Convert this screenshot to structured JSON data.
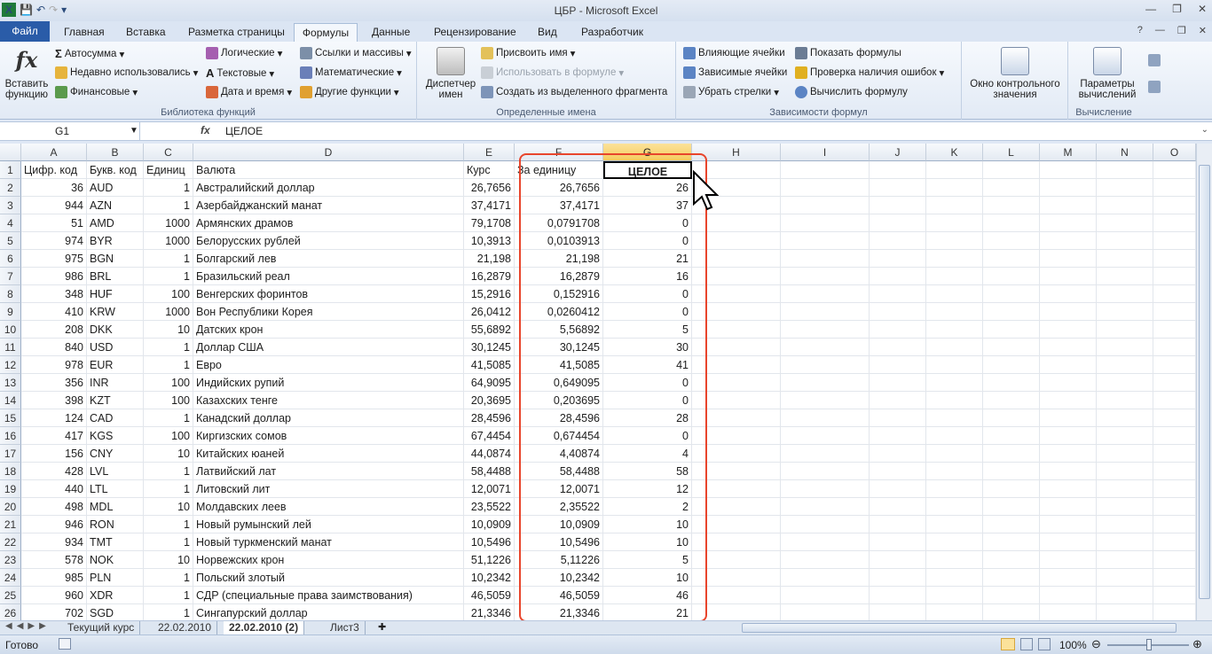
{
  "window": {
    "title": "ЦБР  -  Microsoft Excel"
  },
  "tabs": [
    "Файл",
    "Главная",
    "Вставка",
    "Разметка страницы",
    "Формулы",
    "Данные",
    "Рецензирование",
    "Вид",
    "Разработчик"
  ],
  "ribbon": {
    "insert_function": "Вставить функцию",
    "lib": {
      "autosum": "Автосумма",
      "recent": "Недавно использовались",
      "financial": "Финансовые",
      "logical": "Логические",
      "text": "Текстовые",
      "datetime": "Дата и время",
      "lookup": "Ссылки и массивы",
      "math": "Математические",
      "other": "Другие функции",
      "label": "Библиотека функций"
    },
    "names": {
      "manager": "Диспетчер имен",
      "define": "Присвоить имя",
      "use": "Использовать в формуле",
      "create": "Создать из выделенного фрагмента",
      "label": "Определенные имена"
    },
    "audit": {
      "precedents": "Влияющие ячейки",
      "dependents": "Зависимые ячейки",
      "remove": "Убрать стрелки",
      "show": "Показать формулы",
      "check": "Проверка наличия ошибок",
      "evaluate": "Вычислить формулу",
      "label": "Зависимости формул"
    },
    "watch": "Окно контрольного значения",
    "calc": {
      "options": "Параметры вычислений",
      "label": "Вычисление"
    }
  },
  "formula_bar": {
    "name_box": "G1",
    "fx": "fx",
    "content": "ЦЕЛОЕ"
  },
  "columns": [
    "A",
    "B",
    "C",
    "D",
    "E",
    "F",
    "G",
    "H",
    "I",
    "J",
    "K",
    "L",
    "M",
    "N",
    "O"
  ],
  "header_row": [
    "Цифр. код",
    "Букв. код",
    "Единиц",
    "Валюта",
    "Курс",
    "За единицу",
    "ЦЕЛОЕ"
  ],
  "rows": [
    [
      "36",
      "AUD",
      "1",
      "Австралийский доллар",
      "26,7656",
      "26,7656",
      "26"
    ],
    [
      "944",
      "AZN",
      "1",
      "Азербайджанский манат",
      "37,4171",
      "37,4171",
      "37"
    ],
    [
      "51",
      "AMD",
      "1000",
      "Армянских драмов",
      "79,1708",
      "0,0791708",
      "0"
    ],
    [
      "974",
      "BYR",
      "1000",
      "Белорусских рублей",
      "10,3913",
      "0,0103913",
      "0"
    ],
    [
      "975",
      "BGN",
      "1",
      "Болгарский лев",
      "21,198",
      "21,198",
      "21"
    ],
    [
      "986",
      "BRL",
      "1",
      "Бразильский реал",
      "16,2879",
      "16,2879",
      "16"
    ],
    [
      "348",
      "HUF",
      "100",
      "Венгерских форинтов",
      "15,2916",
      "0,152916",
      "0"
    ],
    [
      "410",
      "KRW",
      "1000",
      "Вон Республики Корея",
      "26,0412",
      "0,0260412",
      "0"
    ],
    [
      "208",
      "DKK",
      "10",
      "Датских крон",
      "55,6892",
      "5,56892",
      "5"
    ],
    [
      "840",
      "USD",
      "1",
      "Доллар США",
      "30,1245",
      "30,1245",
      "30"
    ],
    [
      "978",
      "EUR",
      "1",
      "Евро",
      "41,5085",
      "41,5085",
      "41"
    ],
    [
      "356",
      "INR",
      "100",
      "Индийских рупий",
      "64,9095",
      "0,649095",
      "0"
    ],
    [
      "398",
      "KZT",
      "100",
      "Казахских тенге",
      "20,3695",
      "0,203695",
      "0"
    ],
    [
      "124",
      "CAD",
      "1",
      "Канадский доллар",
      "28,4596",
      "28,4596",
      "28"
    ],
    [
      "417",
      "KGS",
      "100",
      "Киргизских сомов",
      "67,4454",
      "0,674454",
      "0"
    ],
    [
      "156",
      "CNY",
      "10",
      "Китайских юаней",
      "44,0874",
      "4,40874",
      "4"
    ],
    [
      "428",
      "LVL",
      "1",
      "Латвийский лат",
      "58,4488",
      "58,4488",
      "58"
    ],
    [
      "440",
      "LTL",
      "1",
      "Литовский лит",
      "12,0071",
      "12,0071",
      "12"
    ],
    [
      "498",
      "MDL",
      "10",
      "Молдавских леев",
      "23,5522",
      "2,35522",
      "2"
    ],
    [
      "946",
      "RON",
      "1",
      "Новый румынский лей",
      "10,0909",
      "10,0909",
      "10"
    ],
    [
      "934",
      "TMT",
      "1",
      "Новый туркменский манат",
      "10,5496",
      "10,5496",
      "10"
    ],
    [
      "578",
      "NOK",
      "10",
      "Норвежских крон",
      "51,1226",
      "5,11226",
      "5"
    ],
    [
      "985",
      "PLN",
      "1",
      "Польский злотый",
      "10,2342",
      "10,2342",
      "10"
    ],
    [
      "960",
      "XDR",
      "1",
      "СДР (специальные права заимствования)",
      "46,5059",
      "46,5059",
      "46"
    ],
    [
      "702",
      "SGD",
      "1",
      "Сингапурский доллар",
      "21,3346",
      "21,3346",
      "21"
    ]
  ],
  "sheets": [
    "Текущий курс",
    "22.02.2010",
    "22.02.2010 (2)",
    "Лист3"
  ],
  "status": {
    "ready": "Готово",
    "zoom": "100%"
  }
}
